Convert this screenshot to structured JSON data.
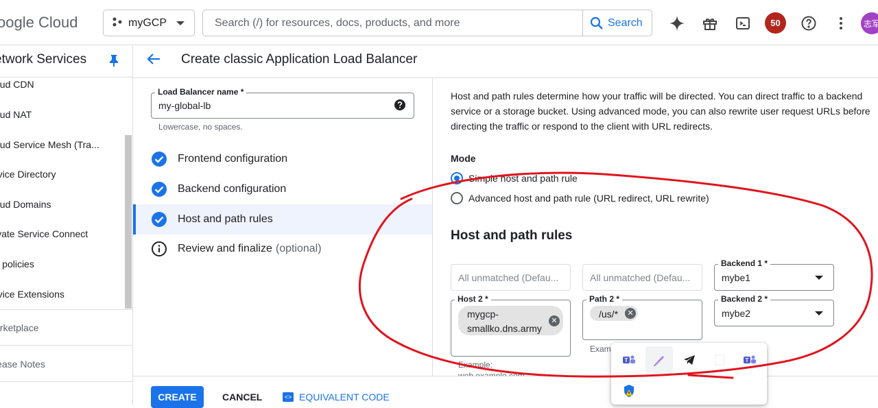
{
  "topbar": {
    "logo_text": "oogle Cloud",
    "project": "myGCP",
    "search_placeholder": "Search (/) for resources, docs, products, and more",
    "search_button": "Search",
    "notification_count": "50",
    "avatar_text": "志军"
  },
  "sidebar": {
    "title": "etwork Services",
    "items": [
      {
        "label": "oud CDN"
      },
      {
        "label": "oud NAT"
      },
      {
        "label": "oud Service Mesh (Tra..."
      },
      {
        "label": "rvice Directory"
      },
      {
        "label": "oud Domains"
      },
      {
        "label": "ivate Service Connect"
      },
      {
        "label": "L policies"
      },
      {
        "label": "rvice Extensions"
      }
    ],
    "marketplace": "arketplace",
    "release_notes": "lease Notes"
  },
  "header": {
    "title": "Create classic Application Load Balancer"
  },
  "lb_name": {
    "label": "Load Balancer name *",
    "value": "my-global-lb",
    "hint": "Lowercase, no spaces."
  },
  "steps": [
    {
      "label": "Frontend configuration",
      "status": "done"
    },
    {
      "label": "Backend configuration",
      "status": "done"
    },
    {
      "label": "Host and path rules",
      "status": "done"
    },
    {
      "label": "Review and finalize",
      "optional": "(optional)",
      "status": "info"
    }
  ],
  "content": {
    "description": "Host and path rules determine how your traffic will be directed. You can direct traffic to a backend service or a storage bucket. Using advanced mode, you can also rewrite user request URLs before directing the traffic or respond to the client with URL redirects.",
    "mode_label": "Mode",
    "mode_options": [
      {
        "label": "Simple host and path rule",
        "selected": true
      },
      {
        "label": "Advanced host and path rule (URL redirect, URL rewrite)",
        "selected": false
      }
    ],
    "rules_heading": "Host and path rules",
    "rules": {
      "row1": {
        "host_placeholder": "All unmatched (Defau...",
        "path_placeholder": "All unmatched (Defau...",
        "backend_label": "Backend 1 *",
        "backend_value": "mybe1"
      },
      "row2": {
        "host_label": "Host 2 *",
        "host_chip_line1": "mygcp-",
        "host_chip_line2": "smallko.dns.army",
        "host_hint_line1": "Example:",
        "host_hint_line2": "web.example.com",
        "path_label": "Path 2 *",
        "path_chip": "/us/*",
        "path_hint": "Exam",
        "backend_label": "Backend 2 *",
        "backend_value": "mybe2"
      }
    }
  },
  "popup_icons": [
    "teams-icon",
    "pen-icon",
    "telegram-icon",
    "blank-icon",
    "teams-icon",
    "shield-icon"
  ],
  "footer": {
    "create": "CREATE",
    "cancel": "CANCEL",
    "equivalent_code": "EQUIVALENT CODE"
  },
  "colors": {
    "accent": "#1a73e8",
    "badge": "#b3261e",
    "annotation": "#e0141e"
  }
}
